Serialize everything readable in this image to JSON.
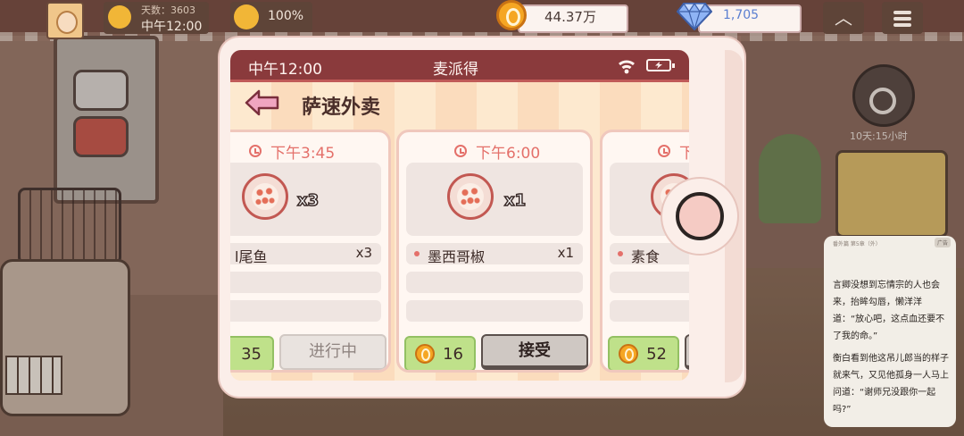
{
  "hud": {
    "day": "天数：3603",
    "clock": "中午12:00",
    "mood": "100%",
    "coins": "44.37万",
    "gems": "1,705"
  },
  "background": {
    "detective_timer": "10天:15小时"
  },
  "phone": {
    "status": {
      "time": "中午12:00",
      "app_name": "麦派得"
    },
    "header": {
      "title": "萨速外卖"
    },
    "orders": [
      {
        "time": "下午3:45",
        "food_qty": "x3",
        "dish": "l尾鱼",
        "dish_qty": "x3",
        "reward": "35",
        "action": "进行中",
        "state": "in-progress"
      },
      {
        "time": "下午6:00",
        "food_qty": "x1",
        "dish": "墨西哥椒",
        "dish_qty": "x1",
        "reward": "16",
        "action": "接受",
        "state": "available"
      },
      {
        "time": "下",
        "food_qty": "",
        "dish": "素食",
        "dish_qty": "",
        "reward": "52",
        "action": "",
        "state": "partial"
      }
    ]
  },
  "ad": {
    "tag": "番外篇 第5章（外）",
    "mark": "广告",
    "paragraph1": "言卿没想到忘情宗的人也会来，抬眸勾唇，懒洋洋道：“放心吧，这点血还要不了我的命。”",
    "paragraph2": "衡白看到他这吊儿郎当的样子就来气，又见他孤身一人马上问道：“谢师兄没跟你一起吗?”"
  },
  "colors": {
    "status_bar": "#8a3a3c",
    "accent_text": "#e4706a",
    "reward_green": "#bfe18a",
    "coin": "#f5a623",
    "gem": "#5b7fd1"
  }
}
